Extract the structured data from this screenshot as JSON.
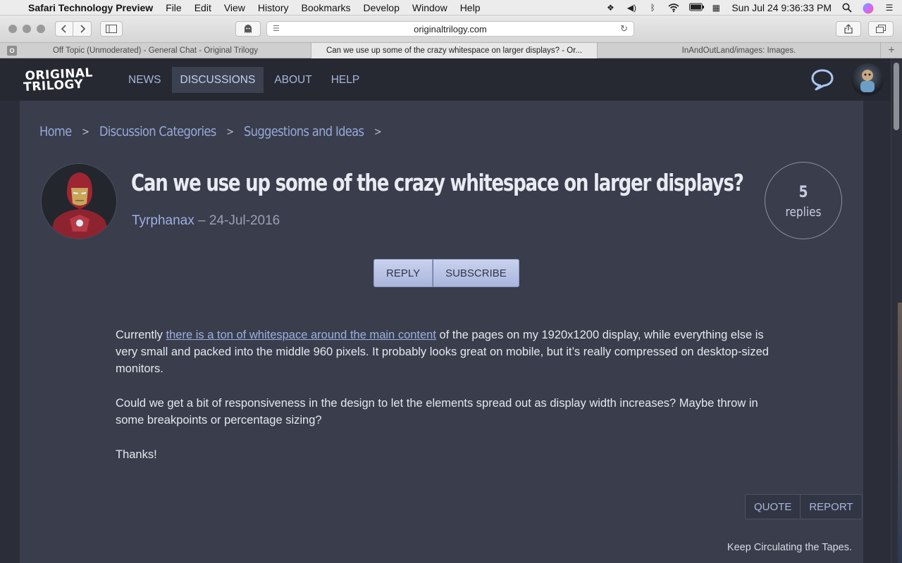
{
  "menubar": {
    "app_name": "Safari Technology Preview",
    "items": [
      "File",
      "Edit",
      "View",
      "History",
      "Bookmarks",
      "Develop",
      "Window",
      "Help"
    ],
    "clock": "Sun Jul 24  9:36:33 PM"
  },
  "browser": {
    "url": "originaltrilogy.com",
    "tabs": [
      {
        "title": "Off Topic (Unmoderated) - General Chat - Original Trilogy",
        "pinned_letter": "O"
      },
      {
        "title": "Can we use up some of the crazy whitespace on larger displays? - Or..."
      },
      {
        "title": "InAndOutLand/images: Images."
      }
    ]
  },
  "site": {
    "logo_line1": "ORIGINAL",
    "logo_line2": "TRILOGY",
    "nav": [
      {
        "label": "NEWS"
      },
      {
        "label": "DISCUSSIONS",
        "active": true
      },
      {
        "label": "ABOUT"
      },
      {
        "label": "HELP"
      }
    ]
  },
  "breadcrumb": [
    "Home",
    "Discussion Categories",
    "Suggestions and Ideas"
  ],
  "thread": {
    "title": "Can we use up some of the crazy whitespace on larger displays?",
    "author": "Tyrphanax",
    "separator": "–",
    "date": "24-Jul-2016",
    "reply_count": "5",
    "reply_label": "replies",
    "reply_button": "REPLY",
    "subscribe_button": "SUBSCRIBE"
  },
  "post": {
    "p1_before": "Currently ",
    "p1_link": "there is a ton of whitespace around the main content",
    "p1_after": " of the pages on my 1920x1200 display, while everything else is very small and packed into the middle 960 pixels. It probably looks great on mobile, but it’s really compressed on desktop-sized monitors.",
    "p2": "Could we get a bit of responsiveness in the design to let the elements spread out as display width increases? Maybe throw in some breakpoints or percentage sizing?",
    "p3": "Thanks!",
    "quote_button": "QUOTE",
    "report_button": "REPORT",
    "signature": "Keep Circulating the Tapes."
  }
}
